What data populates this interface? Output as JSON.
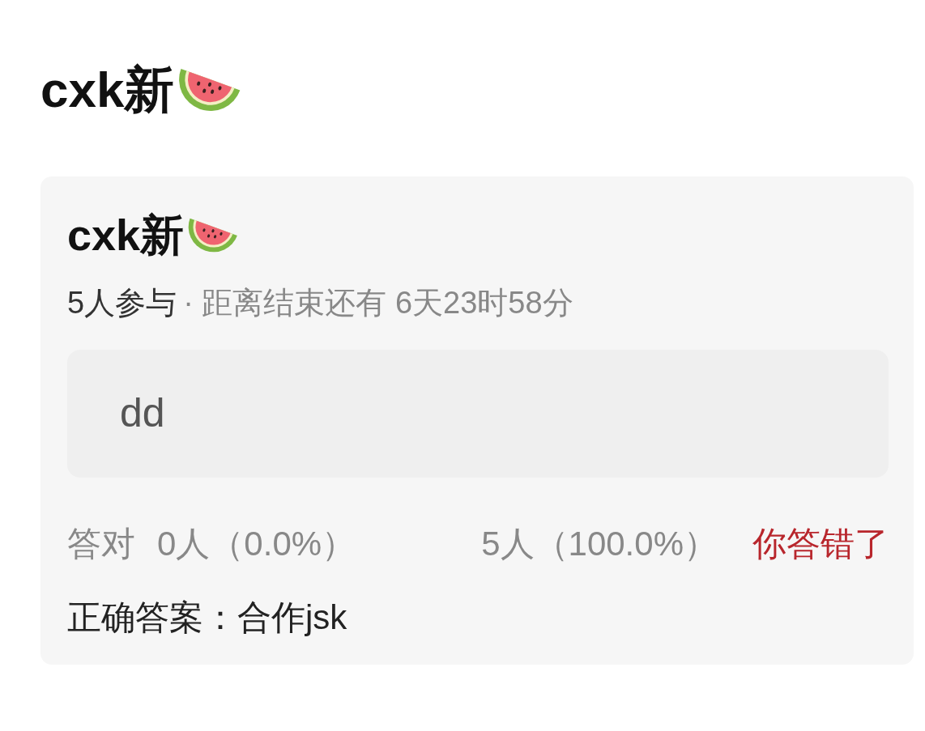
{
  "post": {
    "title": "cxk新"
  },
  "quiz": {
    "title": "cxk新",
    "participants": "5人参与",
    "countdown": "· 距离结束还有 6天23时58分",
    "options": [
      {
        "label": "dd"
      }
    ],
    "stats": {
      "correct_label": "答对",
      "correct_count": "0人（0.0%）",
      "wrong_count": "5人（100.0%）",
      "verdict": {
        "text": "你答错了",
        "kind": "wrong"
      }
    },
    "answer": "正确答案：合作jsk"
  }
}
